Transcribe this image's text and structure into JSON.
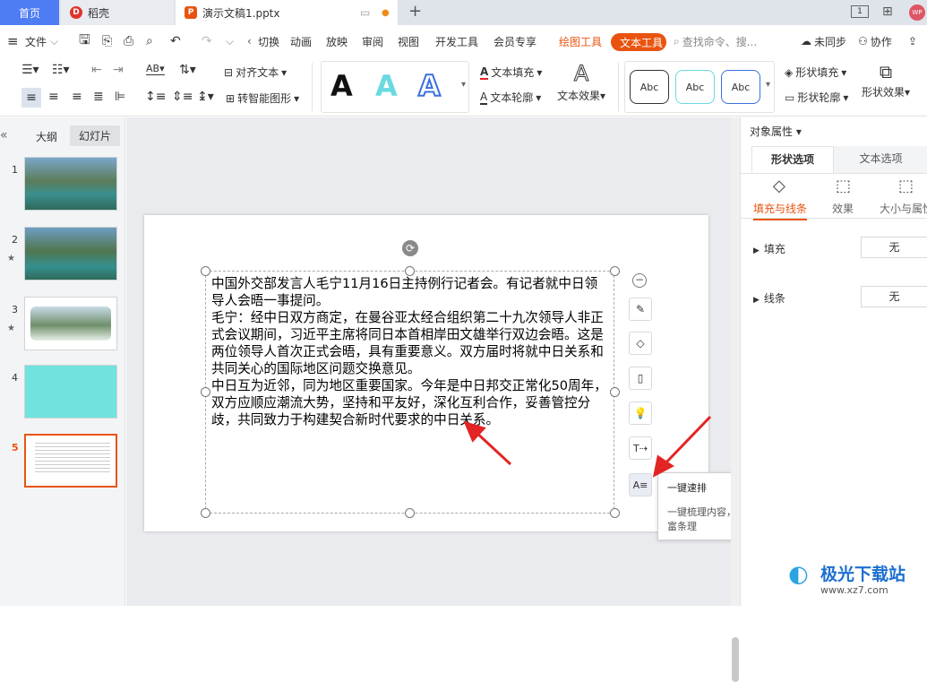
{
  "tabs": {
    "home": "首页",
    "daoke": "稻壳",
    "doc": "演示文稿1.pptx"
  },
  "menu": {
    "file": "文件",
    "items": [
      "切换",
      "动画",
      "放映",
      "审阅",
      "视图",
      "开发工具",
      "会员专享"
    ],
    "drawing_tools": "绘图工具",
    "text_tools": "文本工具",
    "search": "查找命令、搜...",
    "unsync": "未同步",
    "collab": "协作"
  },
  "ribbon": {
    "align_text": "对齐文本",
    "smart_shape": "转智能图形",
    "text_fill": "文本填充",
    "text_outline": "文本轮廓",
    "text_effect": "文本效果",
    "shape_style": "Abc",
    "shape_fill": "形状填充",
    "shape_outline": "形状轮廓",
    "shape_effect": "形状效果",
    "text_styles": [
      "A",
      "A",
      "A"
    ]
  },
  "left_panel": {
    "outline": "大纲",
    "slides": "幻灯片",
    "slide_numbers": [
      "1",
      "2",
      "3",
      "4",
      "5"
    ]
  },
  "slide": {
    "paragraphs": [
      "中国外交部发言人毛宁11月16日主持例行记者会。有记者就中日领导人会晤一事提问。",
      "毛宁：经中日双方商定，在曼谷亚太经合组织第二十九次领导人非正式会议期间，习近平主席将同日本首相岸田文雄举行双边会晤。这是两位领导人首次正式会晤，具有重要意义。双方届时将就中日关系和共同关心的国际地区问题交换意见。",
      "中日互为近邻，同为地区重要国家。今年是中日邦交正常化50周年，双方应顺应潮流大势，坚持和平友好，深化互利合作，妥善管控分歧，共同致力于构建契合新时代要求的中日关系。"
    ]
  },
  "tooltip": {
    "title": "一键速排",
    "desc": "一键梳理内容，让写作更富条理"
  },
  "right_panel": {
    "header": "对象属性",
    "tab_shape": "形状选项",
    "tab_text": "文本选项",
    "sub_fill": "填充与线条",
    "sub_effect": "效果",
    "sub_size": "大小与属性",
    "fill_label": "填充",
    "fill_value": "无",
    "line_label": "线条",
    "line_value": "无"
  },
  "watermark": {
    "name": "极光下载站",
    "url": "www.xz7.com"
  },
  "colors": {
    "accent": "#e8540f",
    "blue": "#4d7cf3",
    "red_arrow": "#e32424"
  }
}
